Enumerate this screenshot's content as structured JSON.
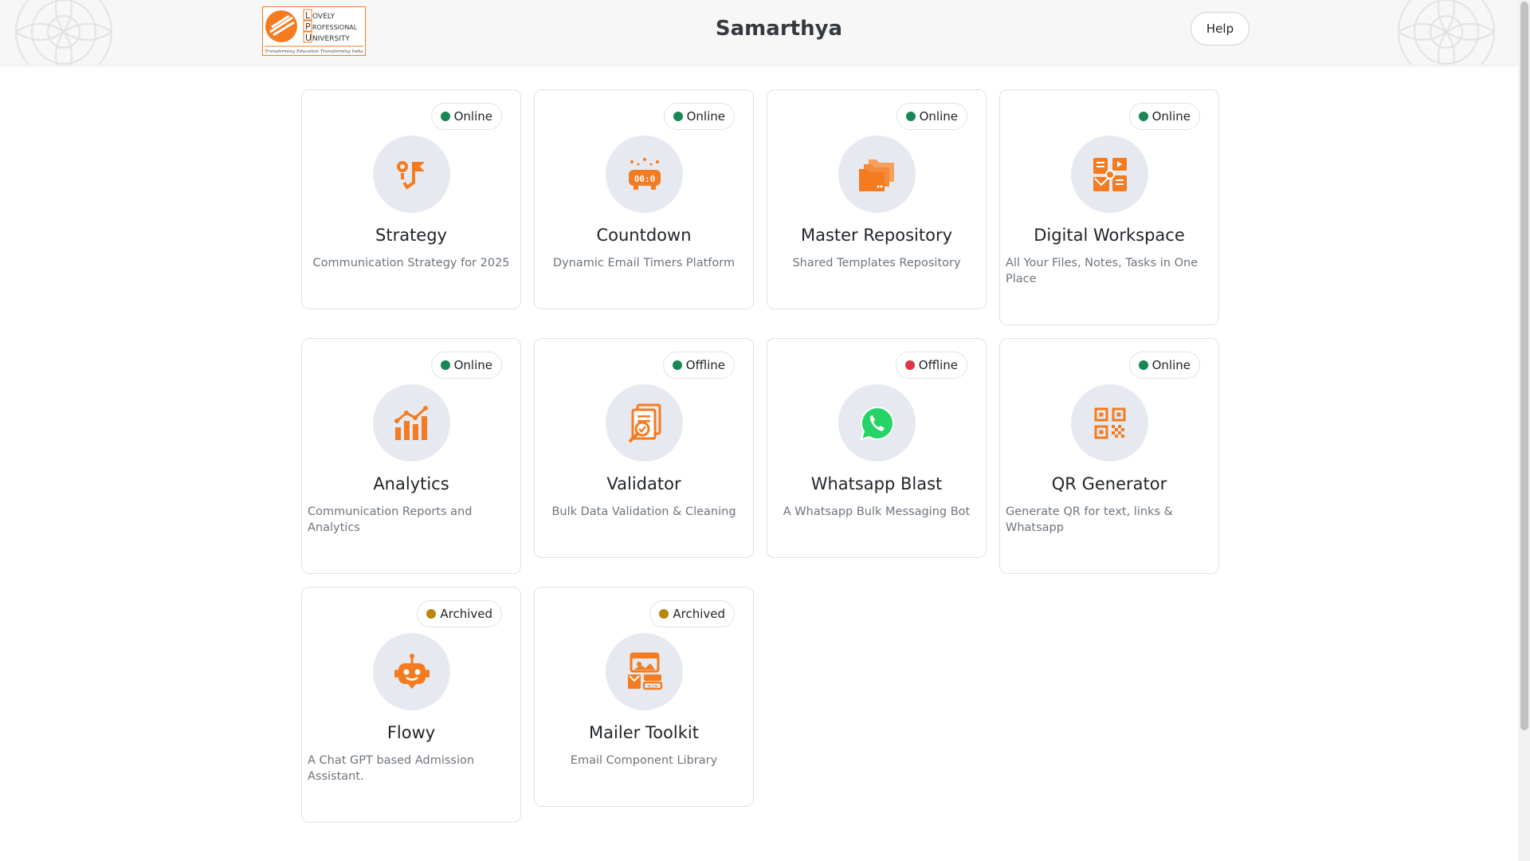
{
  "header": {
    "title": "Samarthya",
    "help_label": "Help",
    "logo": {
      "letters": [
        "L",
        "P",
        "U"
      ],
      "words": [
        "OVELY",
        "ROFESSIONAL",
        "NIVERSITY"
      ],
      "tagline": "Transforming Education Transforming India"
    }
  },
  "colors": {
    "accent": "#f47b20",
    "online": "#198754",
    "offline": "#dc3545",
    "archived": "#b8860b",
    "icon_bg": "#e6eaf0"
  },
  "cards": [
    {
      "title": "Strategy",
      "description": "Communication Strategy for 2025",
      "status": "Online",
      "status_color": "#198754",
      "icon": "strategy-icon"
    },
    {
      "title": "Countdown",
      "description": "Dynamic Email Timers Platform",
      "status": "Online",
      "status_color": "#198754",
      "icon": "timer-icon"
    },
    {
      "title": "Master Repository",
      "description": "Shared Templates Repository",
      "status": "Online",
      "status_color": "#198754",
      "icon": "folders-icon"
    },
    {
      "title": "Digital Workspace",
      "description": "All Your Files, Notes, Tasks in One Place",
      "status": "Online",
      "status_color": "#198754",
      "icon": "workspace-icon"
    },
    {
      "title": "Analytics",
      "description": "Communication Reports and Analytics",
      "status": "Online",
      "status_color": "#198754",
      "icon": "analytics-chart-icon"
    },
    {
      "title": "Validator",
      "description": "Bulk Data Validation & Cleaning",
      "status": "Offline",
      "status_color": "#198754",
      "icon": "document-search-icon"
    },
    {
      "title": "Whatsapp Blast",
      "description": "A Whatsapp Bulk Messaging Bot",
      "status": "Offline",
      "status_color": "#dc3545",
      "icon": "whatsapp-icon"
    },
    {
      "title": "QR Generator",
      "description": "Generate QR for text, links & Whatsapp",
      "status": "Online",
      "status_color": "#198754",
      "icon": "qr-code-icon"
    },
    {
      "title": "Flowy",
      "description": "A Chat GPT based Admission Assistant.",
      "status": "Archived",
      "status_color": "#b8860b",
      "icon": "robot-icon"
    },
    {
      "title": "Mailer Toolkit",
      "description": "Email Component Library",
      "status": "Archived",
      "status_color": "#b8860b",
      "icon": "mailer-components-icon"
    }
  ]
}
